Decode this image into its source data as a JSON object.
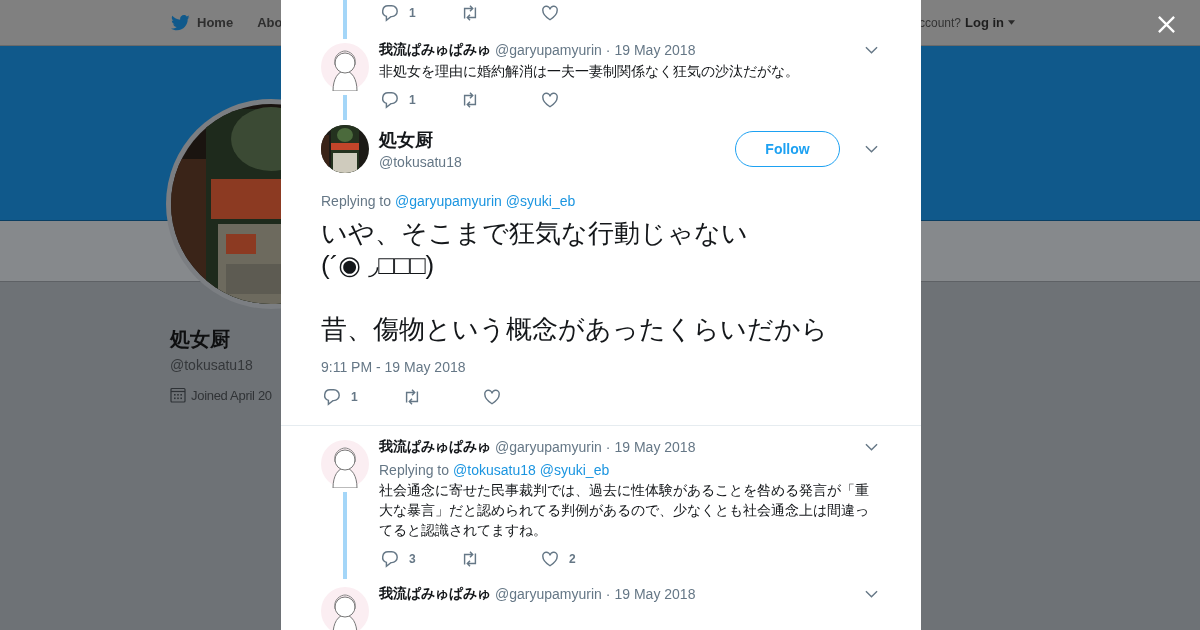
{
  "nav": {
    "items": [
      {
        "label": "Home"
      },
      {
        "label": "Abo"
      }
    ],
    "account_prompt": "ccount?",
    "login": "Log in"
  },
  "profile": {
    "name": "処女厨",
    "handle": "@tokusatu18",
    "joined": "Joined April 20"
  },
  "modal": {
    "top_actions": {
      "replies": "1"
    },
    "replies_above": [
      {
        "name": "我流ぱみゅぱみゅ",
        "handle": "@garyupamyurin",
        "separator": "·",
        "date": "19 May 2018",
        "text": "非処女を理由に婚約解消は一夫一妻制関係なく狂気の沙汰だがな。",
        "replies": "1"
      }
    ],
    "tweet": {
      "name": "処女厨",
      "handle": "@tokusatu18",
      "follow": "Follow",
      "replying_label": "Replying to",
      "replying_to": [
        "@garyupamyurin",
        "@syuki_eb"
      ],
      "paragraphs": [
        [
          "いや、そこまで狂気な行動じゃない",
          "(´◉ ◞□□□)"
        ],
        [
          "昔、傷物という概念があったくらいだから"
        ]
      ],
      "timestamp": "9:11 PM - 19 May 2018",
      "replies": "1"
    },
    "replies_below": [
      {
        "name": "我流ぱみゅぱみゅ",
        "handle": "@garyupamyurin",
        "separator": "·",
        "date": "19 May 2018",
        "replying_label": "Replying to",
        "replying_to": [
          "@tokusatu18",
          "@syuki_eb"
        ],
        "text": "社会通念に寄せた民事裁判では、過去に性体験があることを咎める発言が「重大な暴言」だと認められてる判例があるので、少なくとも社会通念上は間違ってると認識されてますね。",
        "replies": "3",
        "likes": "2"
      },
      {
        "name": "我流ぱみゅぱみゅ",
        "handle": "@garyupamyurin",
        "separator": "·",
        "date": "19 May 2018"
      }
    ]
  }
}
